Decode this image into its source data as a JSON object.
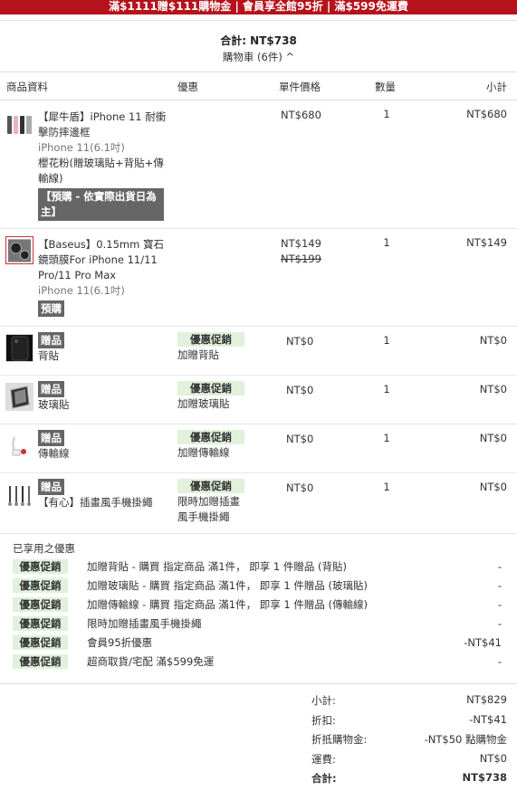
{
  "banner": "滿$1111贈$111購物金 | 會員享全館95折 | 滿$599免運費",
  "header": {
    "total_label": "合計: NT$738",
    "cart_toggle": "購物車 (6件) ^"
  },
  "columns": {
    "product": "商品資料",
    "promo": "優惠",
    "unit_price": "單件價格",
    "qty": "數量",
    "subtotal": "小計"
  },
  "items": [
    {
      "name": "【犀牛盾】iPhone 11 耐衝擊防摔邊框",
      "spec": "iPhone 11(6.1吋)",
      "variant": "櫻花粉(贈玻璃貼+背貼+傳輸線)",
      "tag": "【預購 - 依實際出貨日為主】",
      "price": "NT$680",
      "qty": "1",
      "subtotal": "NT$680"
    },
    {
      "name": "【Baseus】0.15mm 寶石鏡頭膜For iPhone 11/11 Pro/11 Pro Max",
      "spec": "iPhone 11(6.1吋)",
      "tag": "預購",
      "price": "NT$149",
      "original_price": "NT$199",
      "qty": "1",
      "subtotal": "NT$149"
    },
    {
      "tag": "贈品",
      "name": "背貼",
      "promo_tag": "優惠促銷",
      "promo_text": "加贈背貼",
      "price": "NT$0",
      "qty": "1",
      "subtotal": "NT$0"
    },
    {
      "tag": "贈品",
      "name": "玻璃貼",
      "promo_tag": "優惠促銷",
      "promo_text": "加贈玻璃貼",
      "price": "NT$0",
      "qty": "1",
      "subtotal": "NT$0"
    },
    {
      "tag": "贈品",
      "name": "傳輸線",
      "promo_tag": "優惠促銷",
      "promo_text": "加贈傳輸線",
      "price": "NT$0",
      "qty": "1",
      "subtotal": "NT$0"
    },
    {
      "tag": "贈品",
      "name": "【有心】插畫風手機掛繩",
      "promo_tag": "優惠促銷",
      "promo_text": "限時加贈插畫風手機掛繩",
      "price": "NT$0",
      "qty": "1",
      "subtotal": "NT$0"
    }
  ],
  "applied": {
    "title": "已享用之優惠",
    "rows": [
      {
        "tag": "優惠促銷",
        "desc": "加贈背貼 - 購買 指定商品 滿1件， 即享 1 件贈品 (背貼)",
        "amount": "-"
      },
      {
        "tag": "優惠促銷",
        "desc": "加贈玻璃貼 - 購買 指定商品 滿1件， 即享 1 件贈品 (玻璃貼)",
        "amount": "-"
      },
      {
        "tag": "優惠促銷",
        "desc": "加贈傳輸線 - 購買 指定商品 滿1件， 即享 1 件贈品 (傳輸線)",
        "amount": "-"
      },
      {
        "tag": "優惠促銷",
        "desc": "限時加贈插畫風手機掛繩",
        "amount": "-"
      },
      {
        "tag": "優惠促銷",
        "desc": "會員95折優惠",
        "amount": "-NT$41"
      },
      {
        "tag": "優惠促銷",
        "desc": "超商取貨/宅配 滿$599免運",
        "amount": "-"
      }
    ]
  },
  "summary": {
    "subtotal_label": "小計:",
    "subtotal": "NT$829",
    "discount_label": "折扣:",
    "discount": "-NT$41",
    "credit_label": "折抵購物金:",
    "credit": "-NT$50 點購物金",
    "shipping_label": "運費:",
    "shipping": "NT$0",
    "total_label": "合計:",
    "total": "NT$738"
  },
  "colors": {
    "banner_bg": "#b5121b",
    "promo_tag_bg": "#e1f1dc",
    "tag_bg": "#666666"
  }
}
